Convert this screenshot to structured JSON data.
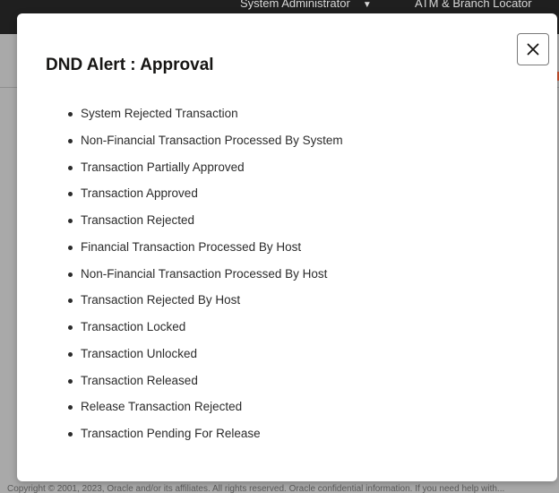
{
  "background": {
    "user_menu": "System Administrator",
    "user_menu_caret": "▼",
    "locator_link": "ATM & Branch Locator",
    "footer_text": "Copyright © 2001, 2023, Oracle and/or its affiliates. All rights reserved. Oracle confidential information. If you need help with..."
  },
  "modal": {
    "title": "DND Alert : Approval",
    "close_icon": "close-icon",
    "items": [
      "System Rejected Transaction",
      "Non-Financial Transaction Processed By System",
      "Transaction Partially Approved",
      "Transaction Approved",
      "Transaction Rejected",
      "Financial Transaction Processed By Host",
      "Non-Financial Transaction Processed By Host",
      "Transaction Rejected By Host",
      "Transaction Locked",
      "Transaction Unlocked",
      "Transaction Released",
      "Release Transaction Rejected",
      "Transaction Pending For Release"
    ]
  },
  "colors": {
    "overlay": "#9a9a9a",
    "topbar": "#1f1f1f",
    "text": "#2b2b2b",
    "title": "#161513"
  }
}
